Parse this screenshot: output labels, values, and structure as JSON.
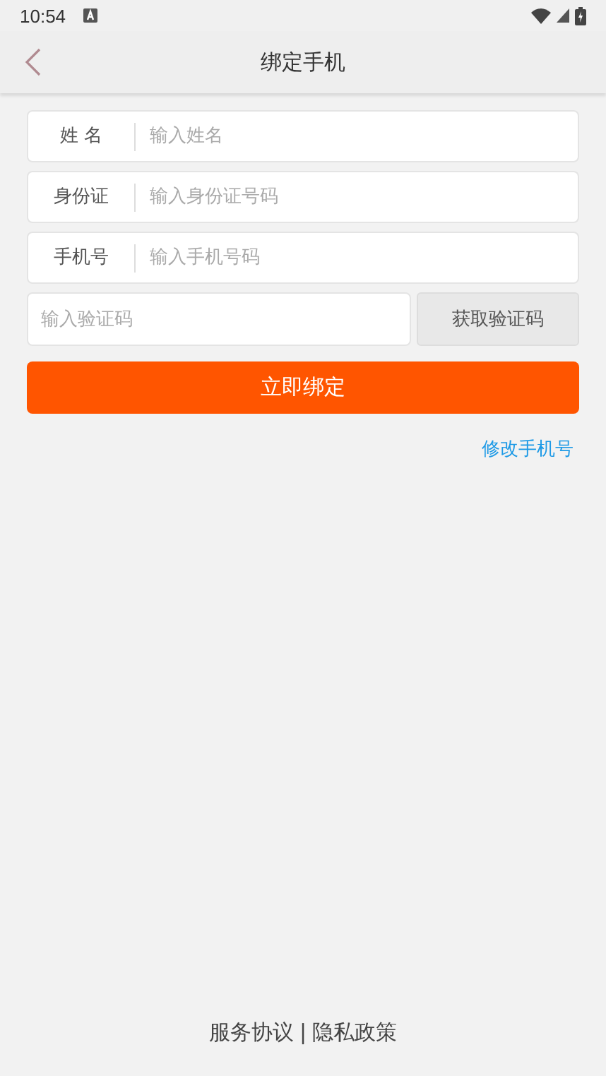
{
  "status_bar": {
    "time": "10:54"
  },
  "header": {
    "title": "绑定手机"
  },
  "form": {
    "fields": [
      {
        "label": "姓 名",
        "placeholder": "输入姓名"
      },
      {
        "label": "身份证",
        "placeholder": "输入身份证号码"
      },
      {
        "label": "手机号",
        "placeholder": "输入手机号码"
      }
    ],
    "code": {
      "placeholder": "输入验证码",
      "button": "获取验证码"
    },
    "submit": "立即绑定",
    "change_link": "修改手机号"
  },
  "footer": {
    "links": [
      "服务协议",
      "隐私政策"
    ],
    "separator": "|"
  }
}
